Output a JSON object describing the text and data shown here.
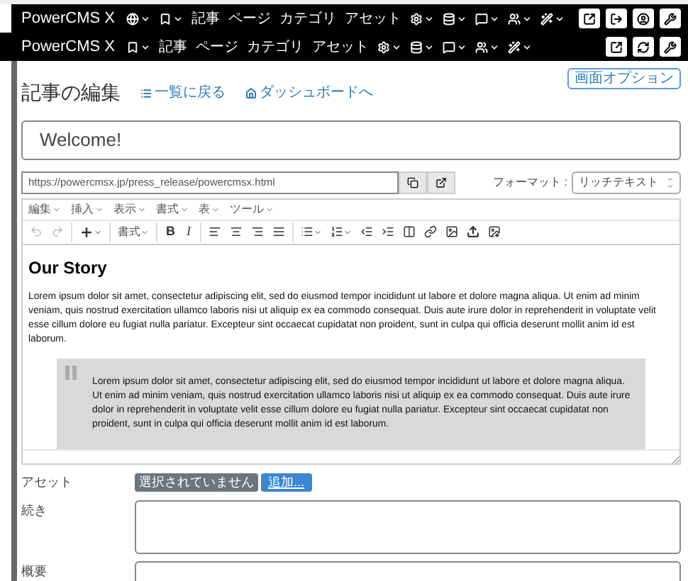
{
  "navbars": [
    {
      "brand": "PowerCMS X",
      "items": [
        {
          "kind": "menu"
        },
        {
          "kind": "menu"
        },
        {
          "kind": "link",
          "label": "記事"
        },
        {
          "kind": "link",
          "label": "ページ"
        },
        {
          "kind": "link",
          "label": "カテゴリ"
        },
        {
          "kind": "link",
          "label": "アセット"
        },
        {
          "kind": "menu"
        },
        {
          "kind": "menu"
        },
        {
          "kind": "menu"
        },
        {
          "kind": "menu"
        },
        {
          "kind": "menu"
        }
      ],
      "buttons": [
        {
          "kind": "button"
        },
        {
          "kind": "button"
        },
        {
          "kind": "button"
        },
        {
          "kind": "button"
        }
      ]
    },
    {
      "brand": "PowerCMS X",
      "items": [
        {
          "kind": "menu"
        },
        {
          "kind": "link",
          "label": "記事"
        },
        {
          "kind": "link",
          "label": "ページ"
        },
        {
          "kind": "link",
          "label": "カテゴリ"
        },
        {
          "kind": "link",
          "label": "アセット"
        },
        {
          "kind": "menu"
        },
        {
          "kind": "menu"
        },
        {
          "kind": "menu"
        },
        {
          "kind": "menu"
        },
        {
          "kind": "menu"
        }
      ],
      "buttons": [
        {
          "kind": "button"
        },
        {
          "kind": "button"
        },
        {
          "kind": "button"
        }
      ]
    }
  ],
  "page": {
    "title": "記事の編集",
    "links": [
      "一覧に戻る",
      "ダッシュボードへ"
    ],
    "screen_options": "画面オプション"
  },
  "title_field": {
    "value": "Welcome!"
  },
  "url_field": {
    "value": "https://powercmsx.jp/press_release/powercmsx.html"
  },
  "format": {
    "label": "フォーマット :",
    "value": "リッチテキスト"
  },
  "editor": {
    "menu": [
      "編集",
      "挿入",
      "表示",
      "書式",
      "表",
      "ツール"
    ],
    "undo_disabled": true,
    "redo_disabled": true,
    "format_label": "書式",
    "bold": "B",
    "italic": "I",
    "heading": "Our Story",
    "paragraph": "Lorem ipsum dolor sit amet, consectetur adipiscing elit, sed do eiusmod tempor incididunt ut labore et dolore magna aliqua. Ut enim ad minim veniam, quis nostrud exercitation ullamco laboris nisi ut aliquip ex ea commodo consequat. Duis aute irure dolor in reprehenderit in voluptate velit esse cillum dolore eu fugiat nulla pariatur. Excepteur sint occaecat cupidatat non proident, sunt in culpa qui officia deserunt mollit anim id est laborum.",
    "quote": "Lorem ipsum dolor sit amet, consectetur adipiscing elit, sed do eiusmod tempor incididunt ut labore et dolore magna aliqua. Ut enim ad minim veniam, quis nostrud exercitation ullamco laboris nisi ut aliquip ex ea commodo consequat. Duis aute irure dolor in reprehenderit in voluptate velit esse cillum dolore eu fugiat nulla pariatur. Excepteur sint occaecat cupidatat non proident, sunt in culpa qui officia deserunt mollit anim id est laborum."
  },
  "fields": [
    {
      "kind": "asset",
      "label": "アセット",
      "status": "選択されていません",
      "button": "追加..."
    },
    {
      "kind": "textarea",
      "label": "続き"
    },
    {
      "kind": "textarea",
      "label": "概要"
    }
  ]
}
